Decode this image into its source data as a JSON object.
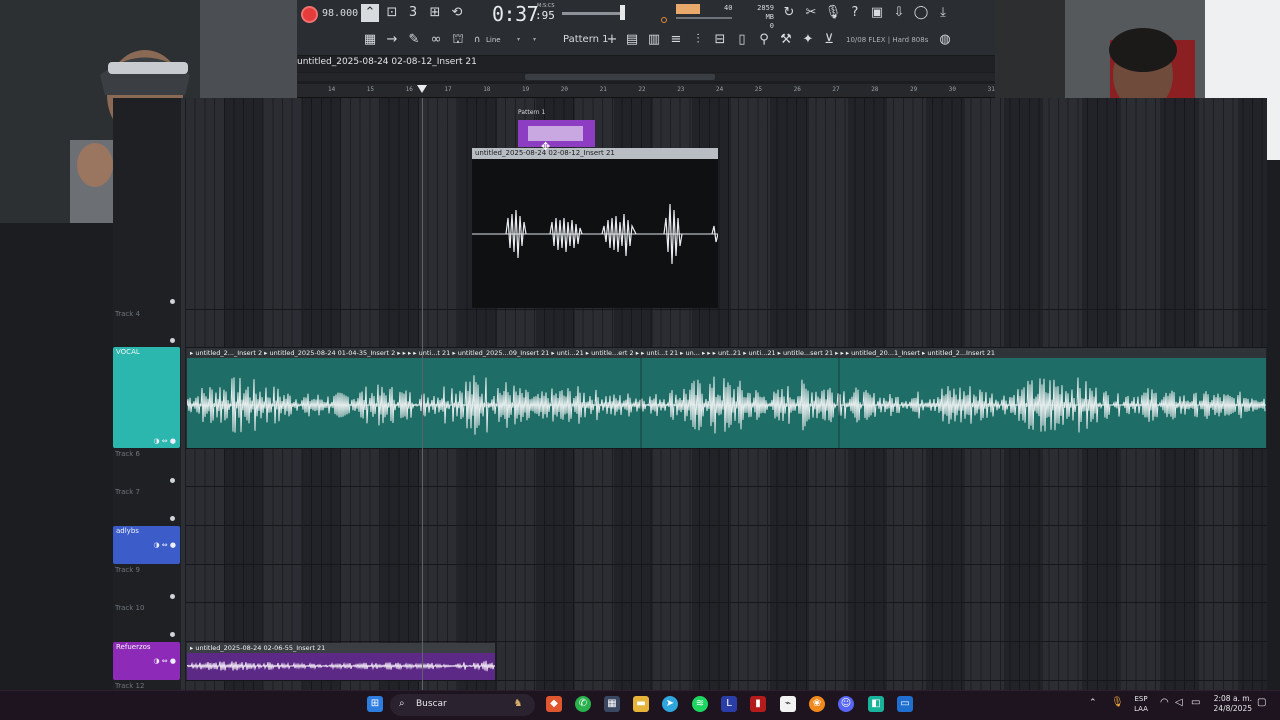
{
  "toolbar": {
    "tempo": "98.000",
    "time_main": "0:37",
    "time_small": ":95",
    "time_unit": "M:S:CS",
    "cpu": "40",
    "memory_line1": "2859 MB",
    "memory_line2": "0",
    "pattern": "Pattern 1",
    "snap": "Line",
    "hint": "10/08  FLEX | Hard 808s"
  },
  "window_title": "untitled_2025-08-24 02-08-12_Insert 21",
  "ruler_ticks": [
    "14",
    "15",
    "16",
    "17",
    "18",
    "19",
    "20",
    "21",
    "22",
    "23",
    "24",
    "25",
    "26",
    "27",
    "28",
    "29",
    "30",
    "31"
  ],
  "tracks": {
    "track4": "Track 4",
    "vocal": "VOCAL",
    "track6": "Track 6",
    "track7": "Track 7",
    "adlybs": "adlybs",
    "track9": "Track 9",
    "track10": "Track 10",
    "refuerzos": "Refuerzos",
    "track12": "Track 12"
  },
  "clips": {
    "pattern_title": "Pattern 1",
    "preview_title": "untitled_2025-08-24 02-08-12_Insert 21",
    "vocal_titles": "▸ untitled_2..._Insert 2  ▸ untitled_2025-08-24 01-04-35_Insert 2 ▸ ▸ ▸   ▸ unti...t 21  ▸ untitled_2025...09_Insert 21  ▸ unti...21  ▸ untitle...ert 2 ▸  ▸ unti...t 21  ▸ un... ▸ ▸ ▸ unt..21  ▸ unti...21  ▸ untitle...sert 21  ▸ ▸  ▸ untitled_20...1_Insert  ▸ untitled_2...Insert 21",
    "refuerzos_title": "▸ untitled_2025-08-24 02-06-55_Insert 21"
  },
  "taskbar": {
    "search_placeholder": "Buscar",
    "lang_line1": "ESP",
    "lang_line2": "LAA",
    "time": "2:08 a. m.",
    "date": "24/8/2025"
  },
  "colors": {
    "vocal_track": "#2bb7ad",
    "adlybs_track": "#3b5cc9",
    "refuerzos_track": "#8e2ab8",
    "record": "#e53b3b"
  }
}
